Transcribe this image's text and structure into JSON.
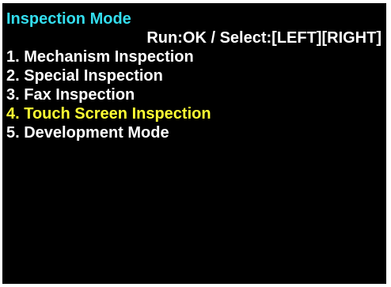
{
  "screen": {
    "title": "Inspection Mode",
    "hint": "Run:OK / Select:[LEFT][RIGHT]",
    "menu": [
      {
        "label": "1. Mechanism Inspection"
      },
      {
        "label": "2. Special Inspection"
      },
      {
        "label": "3. Fax Inspection"
      },
      {
        "label": "4. Touch Screen Inspection"
      },
      {
        "label": "5. Development Mode"
      }
    ],
    "selected_index": 3
  },
  "colors": {
    "background": "#000000",
    "title": "#33ddee",
    "text": "#ffffff",
    "selected": "#ffff33"
  }
}
